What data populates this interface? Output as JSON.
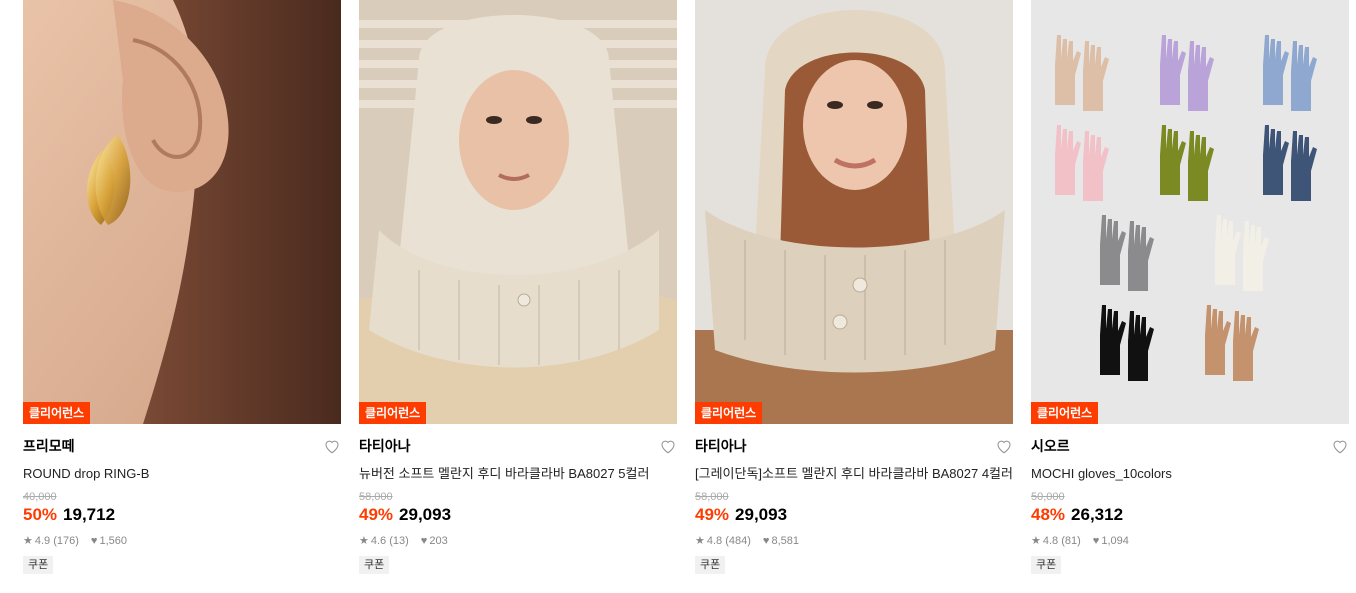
{
  "products": [
    {
      "badge": "클리어런스",
      "brand": "프리모떼",
      "name": "ROUND drop RING-B",
      "original_price": "40,000",
      "discount": "50%",
      "price": "19,712",
      "rating": "4.9",
      "reviews": "(176)",
      "likes": "1,560",
      "coupon": "쿠폰",
      "image": "gold-earring-photo"
    },
    {
      "badge": "클리어런스",
      "brand": "타티아나",
      "name": "뉴버전 소프트 멜란지 후디 바라클라바 BA8027 5컬러",
      "original_price": "58,000",
      "discount": "49%",
      "price": "29,093",
      "rating": "4.6",
      "reviews": "(13)",
      "likes": "203",
      "coupon": "쿠폰",
      "image": "knit-balaclava-photo"
    },
    {
      "badge": "클리어런스",
      "brand": "타티아나",
      "name": "[그레이단독]소프트 멜란지 후디 바라클라바 BA8027 4컬러",
      "original_price": "58,000",
      "discount": "49%",
      "price": "29,093",
      "rating": "4.8",
      "reviews": "(484)",
      "likes": "8,581",
      "coupon": "쿠폰",
      "image": "knit-balaclava-photo"
    },
    {
      "badge": "클리어런스",
      "brand": "시오르",
      "name": "MOCHI gloves_10colors",
      "original_price": "50,000",
      "discount": "48%",
      "price": "26,312",
      "rating": "4.8",
      "reviews": "(81)",
      "likes": "1,094",
      "coupon": "쿠폰",
      "image": "gloves-grid-photo"
    }
  ],
  "colors": {
    "accent": "#ff3c00",
    "muted": "#888888"
  },
  "glove_colors": [
    "#dcbfa6",
    "#b9a3d9",
    "#8fa8cf",
    "#f2c1c8",
    "#7c8a24",
    "#3f5577",
    "#8b8b8d",
    "#f2efe6",
    "#111111",
    "#c4926d"
  ]
}
